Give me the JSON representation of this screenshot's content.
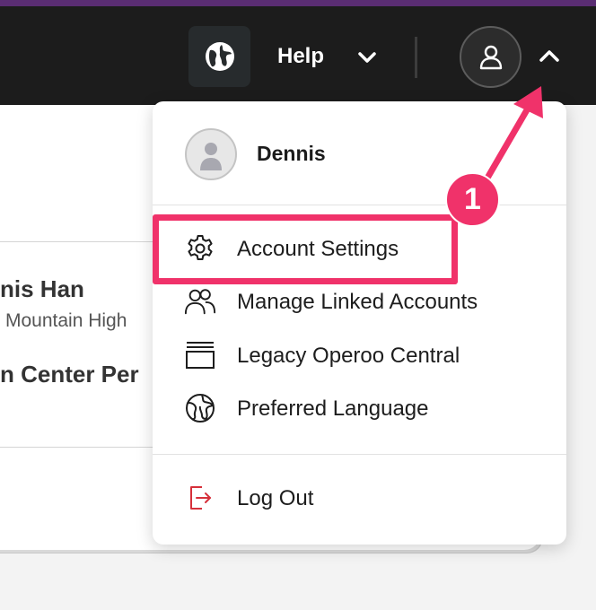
{
  "header": {
    "help_label": "Help",
    "globe_icon": "globe-icon",
    "help_chevron_icon": "chevron-down-icon",
    "avatar_icon": "user-icon",
    "avatar_chevron_icon": "chevron-up-icon"
  },
  "background": {
    "name_fragment": "nis Han",
    "school_fragment": "Mountain High",
    "center_fragment": "n Center Per"
  },
  "dropdown": {
    "username": "Dennis",
    "items": [
      {
        "label": "Account Settings",
        "icon": "gear-icon"
      },
      {
        "label": "Manage Linked Accounts",
        "icon": "users-icon"
      },
      {
        "label": "Legacy Operoo Central",
        "icon": "legacy-window-icon"
      },
      {
        "label": "Preferred Language",
        "icon": "globe-icon"
      }
    ],
    "logout": {
      "label": "Log Out",
      "icon": "logout-icon"
    }
  },
  "annotation": {
    "step_number": "1",
    "color": "#f0326a"
  },
  "colors": {
    "topbar": "#1c1c1c",
    "accent_strip": "#5a2d73",
    "logout_icon": "#d6303a"
  }
}
